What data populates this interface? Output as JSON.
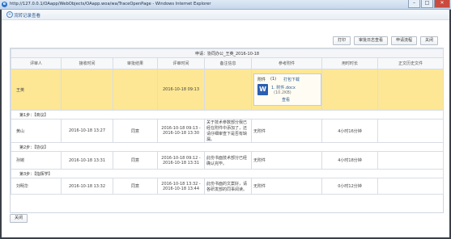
{
  "window": {
    "title": "http://127.0.0.1/OAapp/WebObjects/OAapp.woa/wa/TraceOpenPage - Windows Internet Explorer",
    "minimize": "–",
    "maximize": "□",
    "close": "✕"
  },
  "header": {
    "title": "流转记录查看"
  },
  "toolbar": {
    "print": "打印",
    "audit_log": "审批日志查看",
    "apply_flow": "申请流程",
    "close": "关闭"
  },
  "table": {
    "caption": "申请：协同办公_王英_2016-10-18",
    "columns": [
      "评审人",
      "接收时间",
      "审批结果",
      "评审时间",
      "备注信息",
      "参考附件",
      "用时时长",
      "正文历史文件"
    ],
    "current_row": {
      "reviewer": "王英",
      "review_time": "2016-10-18 09:13",
      "attachment": {
        "label": "附件",
        "count": "(1)",
        "download": "打包下载",
        "file_name": "1. 附件.docx",
        "file_size": "(10.2KB)",
        "view": "查看"
      }
    },
    "steps": [
      {
        "label": "第1步：【商议】",
        "reviewer": "黄山",
        "received": "2016-10-18 13:27",
        "result": "同意",
        "review_time": "2016-10-18 09:13 - 2016-10-18 13:30",
        "remark": "关于技术参数部分我已经在附件中添加了，还请仔细审查下是否有缺漏。",
        "attachment": "无附件",
        "duration": "4小时16分钟",
        "history": ""
      },
      {
        "label": "第2步：【协议】",
        "reviewer": "孙婉",
        "received": "2016-10-18 13:31",
        "result": "同意",
        "review_time": "2016-10-18 09:12 - 2016-10-18 13:31",
        "remark": "此份书面技术部分已经确认完毕。",
        "attachment": "无附件",
        "duration": "4小时18分钟",
        "history": ""
      },
      {
        "label": "第3步：【指挥学】",
        "reviewer": "刘明华",
        "received": "2016-10-18 13:32",
        "result": "同意",
        "review_time": "2016-10-18 13:32 - 2016-10-18 13:44",
        "remark": "此份书面的文案好，请各研发部的同事阅读。",
        "attachment": "无附件",
        "duration": "0小时12分钟",
        "history": ""
      }
    ]
  },
  "footer": {
    "close": "关闭"
  }
}
